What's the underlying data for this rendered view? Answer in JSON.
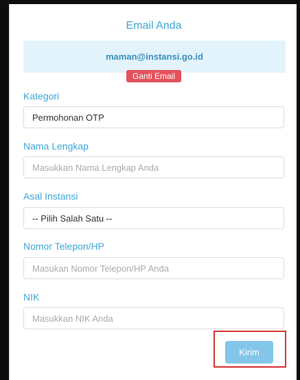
{
  "form": {
    "title": "Email Anda",
    "email": "maman@instansi.go.id",
    "change_email_label": "Ganti Email",
    "fields": {
      "kategori": {
        "label": "Kategori",
        "value": "Permohonan OTP"
      },
      "nama": {
        "label": "Nama Lengkap",
        "placeholder": "Masukkan Nama Lengkap Anda"
      },
      "instansi": {
        "label": "Asal Instansi",
        "value": "-- Pilih Salah Satu --"
      },
      "telepon": {
        "label": "Nomor Telepon/HP",
        "placeholder": "Masukan Nomor Telepon/HP Anda"
      },
      "nik": {
        "label": "NIK",
        "placeholder": "Masukkan NIK Anda"
      }
    },
    "submit_label": "Kirim"
  },
  "colors": {
    "accent": "#3fa7d6",
    "email_bg": "#e3f3fb",
    "danger": "#e4525c",
    "submit": "#84c6ea",
    "highlight": "#d73333"
  }
}
